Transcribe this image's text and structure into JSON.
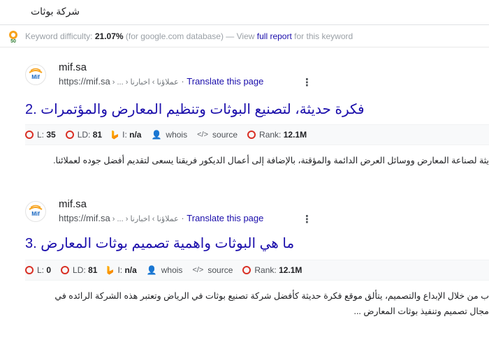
{
  "search": {
    "query": "شركة بوثات"
  },
  "keyword_bar": {
    "prefix": "Keyword difficulty:",
    "value": "21.07%",
    "database": "(for google.com database) — View",
    "report_link": "full report",
    "suffix": "for this keyword"
  },
  "results": [
    {
      "site_name": "mif.sa",
      "url": "https://mif.sa",
      "crumbs": " › ... › عملاؤنا › اخبارنا",
      "translate": "Translate this page",
      "number": "2.",
      "title": "فكرة حديثة، لتصنيع البوثات وتنظيم المعارض والمؤتمرات",
      "metrics": {
        "l_label": "L:",
        "l_value": "35",
        "ld_label": "LD:",
        "ld_value": "81",
        "i_label": "I:",
        "i_value": "n/a",
        "whois": "whois",
        "source": "source",
        "rank_label": "Rank:",
        "rank_value": "12.1M"
      },
      "snippet": [
        "يثة لصناعة المعارض ووسائل العرض الدائمة والمؤقتة، بالإضافة إلى أعمال الديكور فريقنا يسعى لتقديم أفضل جوده لعملائنا."
      ]
    },
    {
      "site_name": "mif.sa",
      "url": "https://mif.sa",
      "crumbs": " › ... › عملاؤنا › اخبارنا",
      "translate": "Translate this page",
      "number": "3.",
      "title": "ما هي البوثات واهمية تصميم بوثات المعارض",
      "metrics": {
        "l_label": "L:",
        "l_value": "0",
        "ld_label": "LD:",
        "ld_value": "81",
        "i_label": "I:",
        "i_value": "n/a",
        "whois": "whois",
        "source": "source",
        "rank_label": "Rank:",
        "rank_value": "12.1M"
      },
      "snippet": [
        "ب من خلال الإبداع والتصميم، يتألق موقع فكرة حديثة كأفضل شركة تصنيع بوثات في الرياض وتعتبر هذه الشركة الرائده في",
        "مجال تصميم وتنفيذ بوثات المعارض ..."
      ]
    }
  ],
  "colors": {
    "link": "#1a0dab",
    "ring": "#d93025",
    "bing": "#f57c00"
  }
}
